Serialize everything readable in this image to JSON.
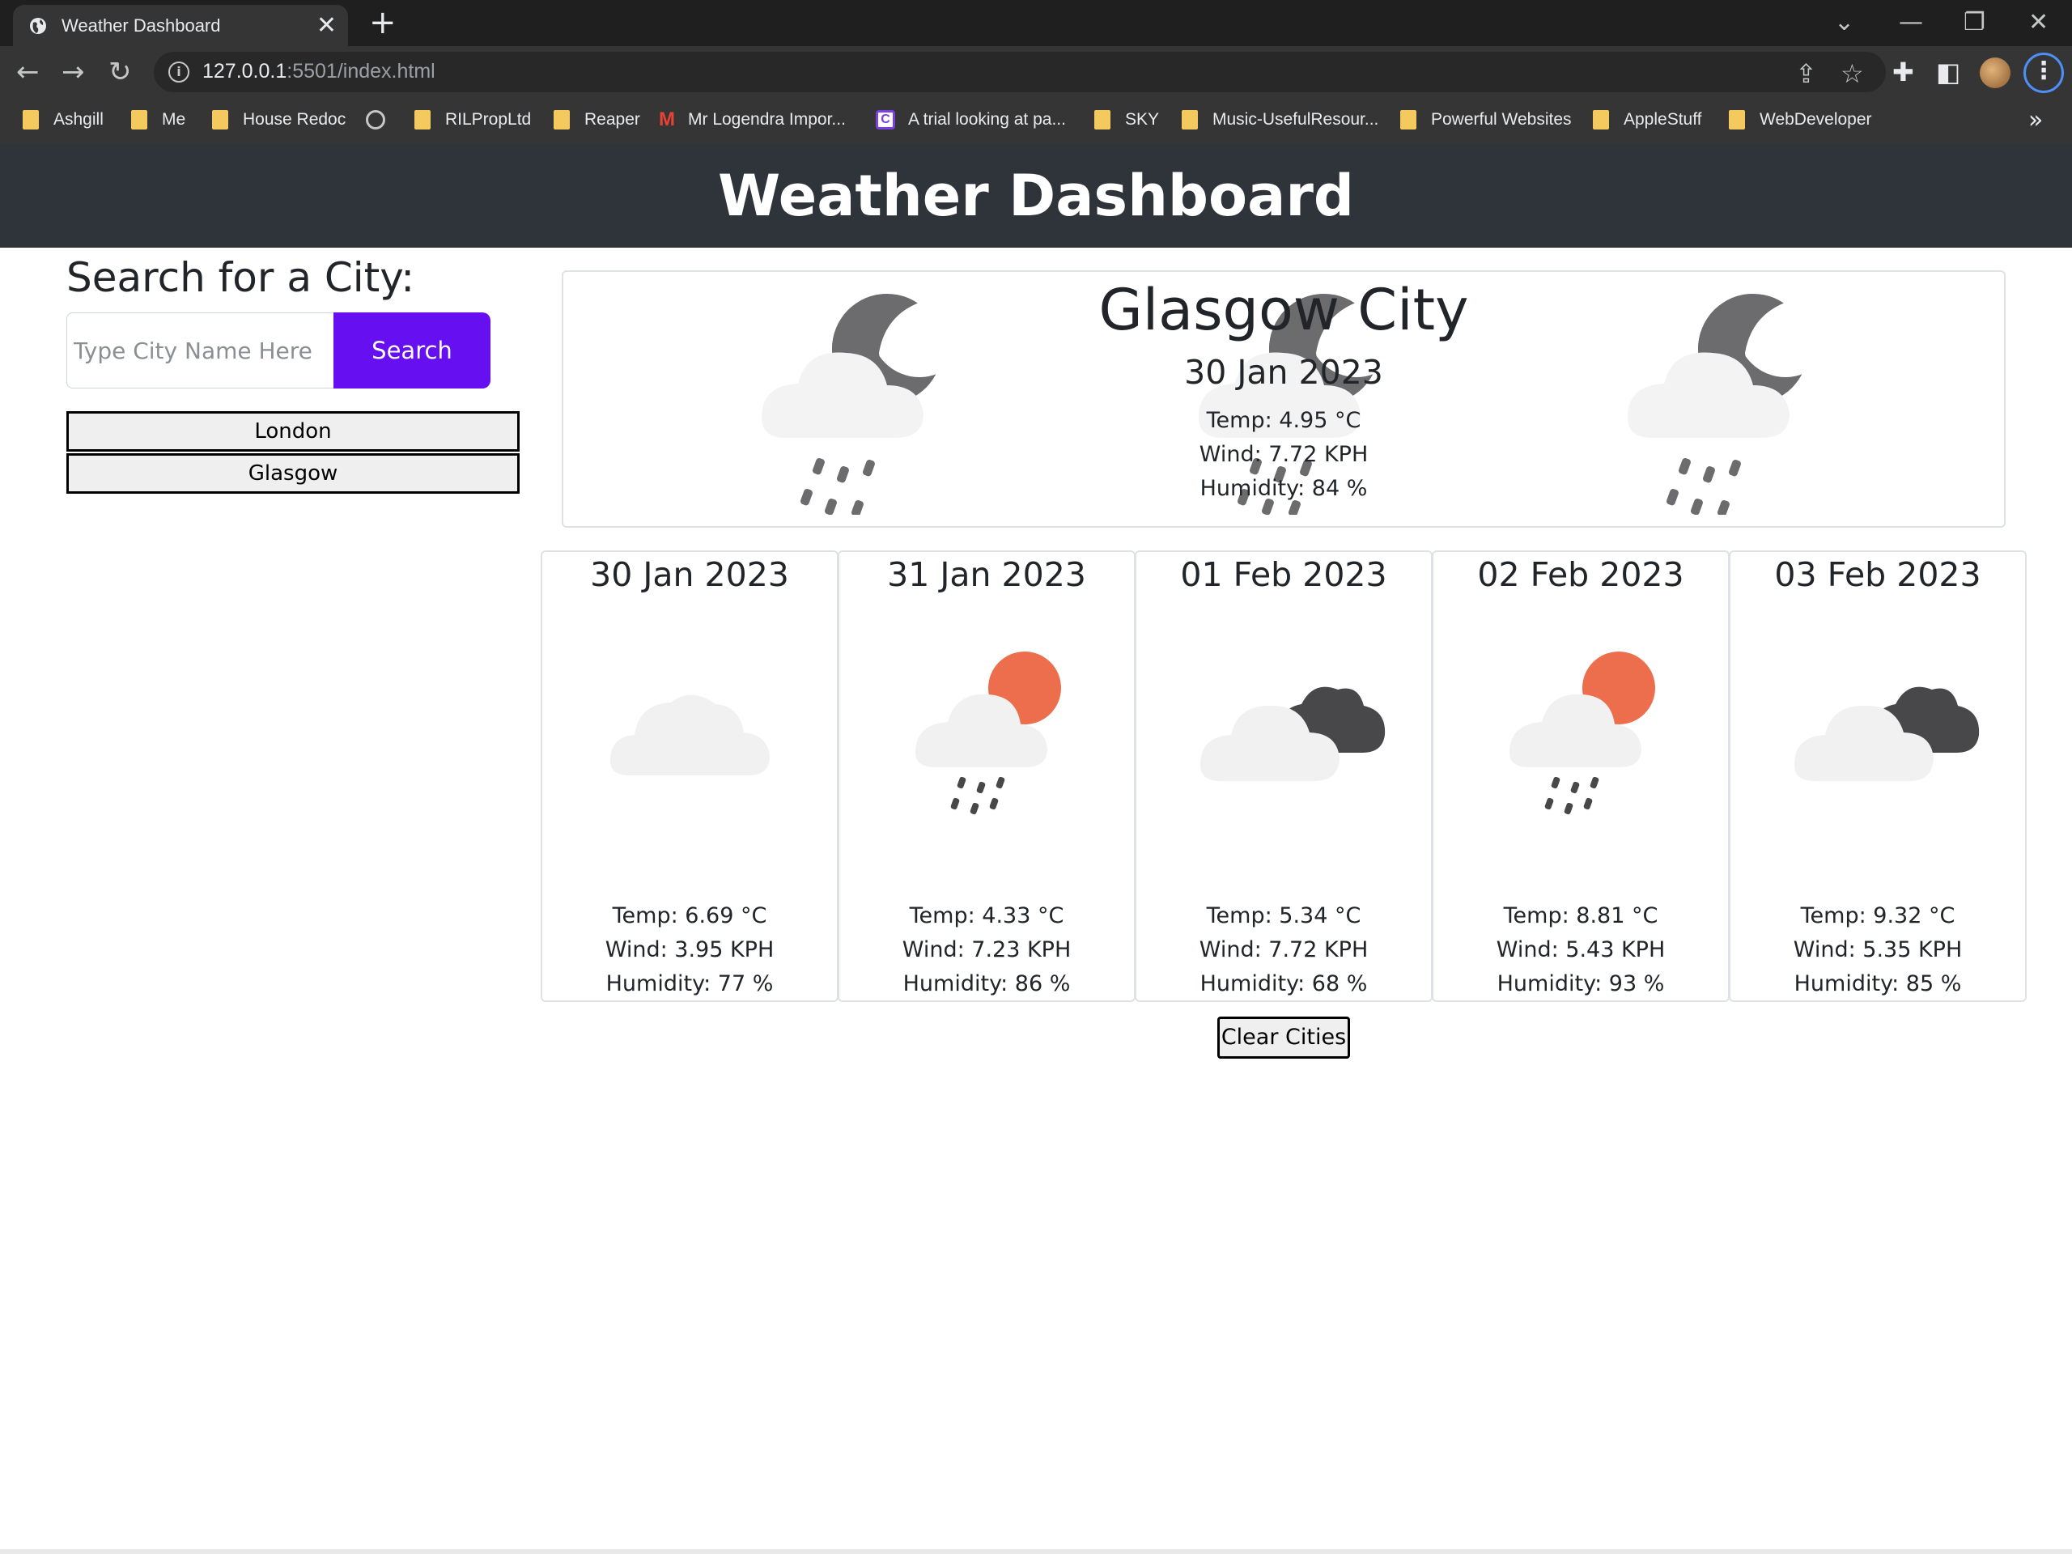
{
  "browser": {
    "tab_title": "Weather Dashboard",
    "tab_close": "✕",
    "new_tab": "+",
    "url_host": "127.0.0.1",
    "url_path": ":5501/index.html",
    "bookmarks": [
      "Ashgill",
      "Me",
      "House Redoc",
      "",
      "RILPropLtd",
      "Reaper",
      "Mr Logendra Impor...",
      "A trial looking at pa...",
      "SKY",
      "Music-UsefulResour...",
      "Powerful Websites",
      "AppleStuff",
      "WebDeveloper"
    ],
    "more_bookmarks": "»"
  },
  "header": {
    "title": "Weather Dashboard"
  },
  "search": {
    "heading": "Search for a City:",
    "placeholder": "Type City Name Here",
    "button": "Search"
  },
  "history": [
    "London",
    "Glasgow"
  ],
  "current": {
    "city": "Glasgow City",
    "date": "30 Jan 2023",
    "temp": "Temp: 4.95 °C",
    "wind": "Wind: 7.72 KPH",
    "humidity": "Humidity: 84 %",
    "icon": "rain-night-icon"
  },
  "forecast": [
    {
      "date": "30 Jan 2023",
      "icon": "cloud-icon",
      "temp": "Temp: 6.69 °C",
      "wind": "Wind: 3.95 KPH",
      "humidity": "Humidity: 77 %"
    },
    {
      "date": "31 Jan 2023",
      "icon": "rain-sun-icon",
      "temp": "Temp: 4.33 °C",
      "wind": "Wind: 7.23 KPH",
      "humidity": "Humidity: 86 %"
    },
    {
      "date": "01 Feb 2023",
      "icon": "broken-clouds-icon",
      "temp": "Temp: 5.34 °C",
      "wind": "Wind: 7.72 KPH",
      "humidity": "Humidity: 68 %"
    },
    {
      "date": "02 Feb 2023",
      "icon": "rain-sun-icon",
      "temp": "Temp: 8.81 °C",
      "wind": "Wind: 5.43 KPH",
      "humidity": "Humidity: 93 %"
    },
    {
      "date": "03 Feb 2023",
      "icon": "broken-clouds-icon",
      "temp": "Temp: 9.32 °C",
      "wind": "Wind: 5.35 KPH",
      "humidity": "Humidity: 85 %"
    }
  ],
  "clear_button": "Clear Cities",
  "colors": {
    "header_bg": "#2f343b",
    "search_button": "#6610f2",
    "sun": "#ec6e4c",
    "dark_cloud": "#48484a",
    "light_cloud": "#f1f1f1"
  }
}
